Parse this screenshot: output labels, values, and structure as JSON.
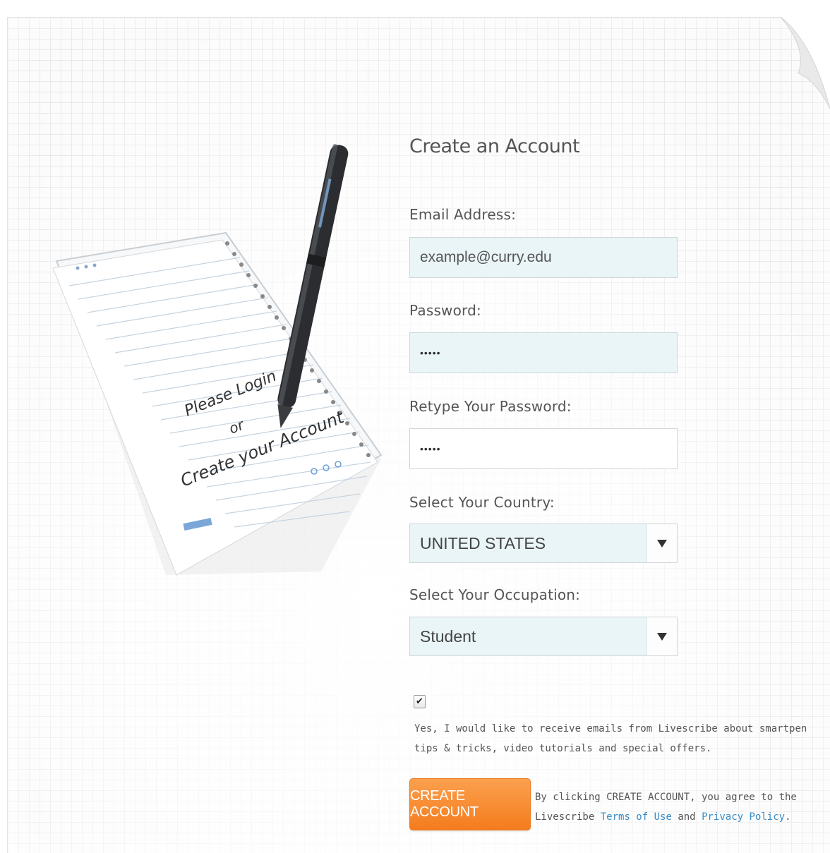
{
  "form": {
    "title": "Create an Account",
    "email_label": "Email Address:",
    "email_value": "example@curry.edu",
    "password_label": "Password:",
    "password_value": "•••••",
    "retype_label": "Retype Your Password:",
    "retype_value": "•••••",
    "country_label": "Select Your Country:",
    "country_value": "UNITED STATES",
    "occupation_label": "Select Your Occupation:",
    "occupation_value": "Student",
    "optin_checked": true,
    "optin_text": "Yes, I would like to receive emails from Livescribe about smartpen tips & tricks, video tutorials and special offers.",
    "create_button": "CREATE ACCOUNT",
    "legal_prefix": "By clicking CREATE ACCOUNT, you agree to the Livescribe",
    "terms_link": "Terms of Use",
    "legal_and": "and",
    "privacy_link": "Privacy Policy",
    "legal_suffix": "."
  },
  "illustration": {
    "handwriting_line1": "Please Login",
    "handwriting_line2": "or",
    "handwriting_line3": "Create your Account"
  },
  "colors": {
    "accent_orange": "#f47c1d",
    "field_bg": "#eaf5f7",
    "link_blue": "#3b8bc4"
  }
}
